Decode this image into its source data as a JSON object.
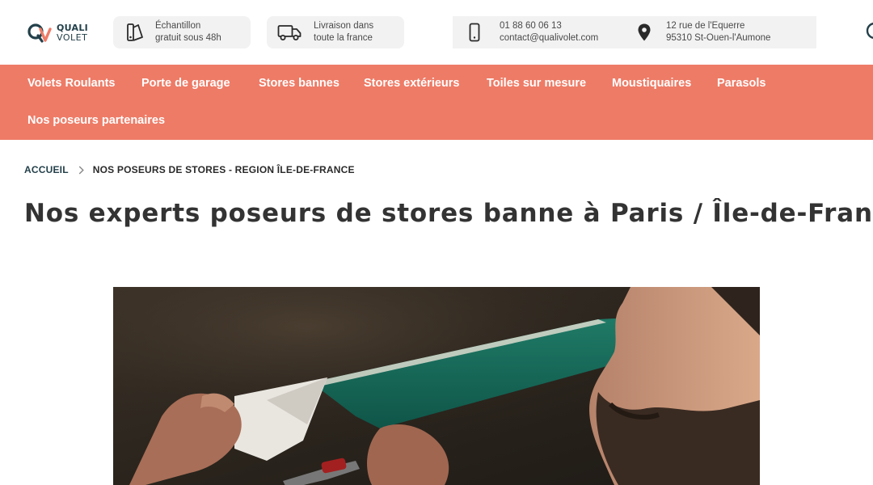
{
  "brand": {
    "line1": "QUALI",
    "line2": "VOLET",
    "accent": "#ee7b66",
    "dark": "#23404a"
  },
  "header": {
    "sample": {
      "line1": "Échantillon",
      "line2": "gratuit sous 48h",
      "icon": "swatch-icon"
    },
    "delivery": {
      "line1": "Livraison dans",
      "line2": "toute la france",
      "icon": "truck-icon"
    },
    "contact": {
      "phone": "01 88 60 06 13",
      "email": "contact@qualivolet.com",
      "address_line1": "12 rue de l'Equerre",
      "address_line2": "95310 St-Ouen-l'Aumone",
      "phone_icon": "phone-icon",
      "address_icon": "location-pin-icon"
    },
    "search_icon": "search-icon"
  },
  "nav": {
    "items": [
      {
        "label": "Volets Roulants"
      },
      {
        "label": "Porte de garage"
      },
      {
        "label": "Stores bannes"
      },
      {
        "label": "Stores extérieurs"
      },
      {
        "label": "Toiles sur mesure"
      },
      {
        "label": "Moustiquaires"
      },
      {
        "label": "Parasols"
      },
      {
        "label": "Nos poseurs partenaires"
      }
    ],
    "background": "#ee7b66"
  },
  "breadcrumb": {
    "home": "ACCUEIL",
    "current": "NOS POSEURS DE STORES - REGION ÎLE-DE-FRANCE"
  },
  "page": {
    "title": "Nos experts poseurs de stores banne à Paris / Île-de-France"
  }
}
